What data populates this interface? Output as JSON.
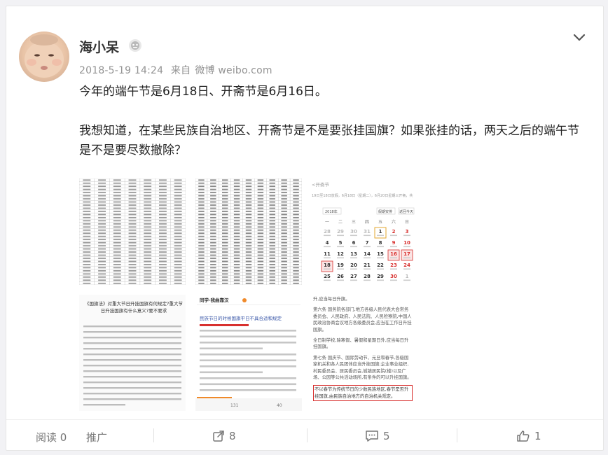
{
  "post": {
    "username": "海小呆",
    "timestamp": "2018-5-19 14:24",
    "source_prefix": "来自",
    "source": "微博 weibo.com",
    "text_lines": [
      "今年的端午节是6月18日、开斋节是6月16日。",
      "我想知道，在某些民族自治地区、开斋节是不是要张挂国旗？如果张挂的话，两天之后的端午节是不是要尽数撤除？"
    ]
  },
  "thumbnails": {
    "t3": {
      "header": "<开斋节",
      "line": "19日至18日放假，6月18日（星期二），6月20日星期三开斋，共",
      "calendar": {
        "year_select": "2018年",
        "holiday_select": "假期安排",
        "today_button": "返回今天",
        "weekdays": [
          "一",
          "二",
          "三",
          "四",
          "五",
          "六",
          "日"
        ],
        "rows": [
          [
            "28",
            "29",
            "30",
            "31",
            "1",
            "2",
            "3"
          ],
          [
            "4",
            "5",
            "6",
            "7",
            "8",
            "9",
            "10"
          ],
          [
            "11",
            "12",
            "13",
            "14",
            "15",
            "16",
            "17"
          ],
          [
            "18",
            "19",
            "20",
            "21",
            "22",
            "23",
            "24"
          ],
          [
            "25",
            "26",
            "27",
            "28",
            "29",
            "30",
            "1"
          ]
        ]
      }
    },
    "t4": {
      "title": "《国旗法》对重大节日升挂国旗有何规定?重大节日升挂国旗有什么意义?要不要求"
    },
    "t5": {
      "header": "同学·我曲靠汉",
      "title": "民族节日的时候国旗平日不具合适和规定",
      "like_count": "131",
      "comment_count": "40"
    },
    "t6": {
      "lines": [
        "升,应当每日升旗。",
        "第六条 国务院各部门,地方各级人民代表大会常务委员会、人民政府、人民法院、人民检察院,中国人民政治协商会议地方各级委员会,应当在工作日升挂国旗。",
        "全日制学校,除寒假、暑假和星期日外,应当每日升挂国旗。",
        "第七条 国庆节、国际劳动节、元旦和春节,各级国家机关和各人民团体应当升挂国旗;企业事业组织,村民委员会、居民委员会,城镇居民院(楼)以及广场、公园等公共活动场所,有条件的可以升挂国旗。",
        "不以春节为传统节日的少数民族地区,春节是否升挂国旗,由民族自治地方的自治机关规定。"
      ]
    }
  },
  "footer": {
    "read_label": "阅读",
    "read_count": "0",
    "promote_label": "推广",
    "share_count": "8",
    "comment_count": "5",
    "like_count": "1"
  },
  "colors": {
    "accent_orange": "#f08a2a",
    "highlight_red": "#d8302e",
    "muted": "#939393"
  }
}
